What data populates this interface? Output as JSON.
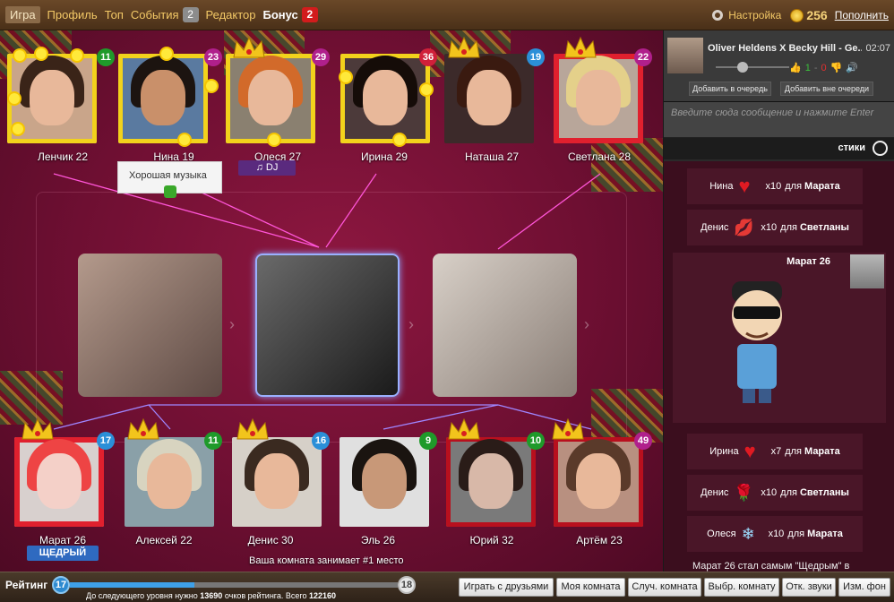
{
  "nav": {
    "items": [
      {
        "label": "Игра"
      },
      {
        "label": "Профиль"
      },
      {
        "label": "Топ"
      },
      {
        "label": "События",
        "badge": "2"
      },
      {
        "label": "Редактор"
      },
      {
        "label": "Бонус",
        "badge": "2"
      }
    ]
  },
  "topright": {
    "settings_label": "Настройка",
    "coins": "256",
    "topup_label": "Пополнить"
  },
  "players_top": [
    {
      "name": "Ленчик 22",
      "level": "11"
    },
    {
      "name": "Нина 19",
      "level": "23"
    },
    {
      "name": "Олеся 27",
      "level": "29",
      "tag": "♫ DJ"
    },
    {
      "name": "Ирина 29",
      "level": "36"
    },
    {
      "name": "Наташа 27",
      "level": "19"
    },
    {
      "name": "Светлана 28",
      "level": "22"
    }
  ],
  "players_bottom": [
    {
      "name": "Марат 26",
      "level": "17",
      "tag": "ЩЕДРЫЙ"
    },
    {
      "name": "Алексей 22",
      "level": "11"
    },
    {
      "name": "Денис 30",
      "level": "16"
    },
    {
      "name": "Эль 26",
      "level": "9"
    },
    {
      "name": "Юрий 32",
      "level": "10"
    },
    {
      "name": "Артём 23",
      "level": "49"
    }
  ],
  "tooltip": {
    "text": "Хорошая музыка"
  },
  "room_rank": "Ваша комната занимает #1 место",
  "player": {
    "track": "Oliver Heldens X Becky Hill - Ge...",
    "time": "02:07",
    "likes": "1",
    "dislikes": "0",
    "queue_label": "Добавить в очередь",
    "queue_out_label": "Добавить вне очереди"
  },
  "chat": {
    "placeholder": "Введите сюда сообщение и нажмите Enter",
    "stickers_label": "стики"
  },
  "feed": {
    "gifts_top": [
      {
        "from": "Нина",
        "count": "x10",
        "for_word": "для",
        "to": "Марата",
        "icon": "heart-icon"
      },
      {
        "from": "Денис",
        "count": "x10",
        "for_word": "для",
        "to": "Светланы",
        "icon": "kiss-icon"
      }
    ],
    "post": {
      "author": "Марат 26"
    },
    "gifts_bottom": [
      {
        "from": "Ирина",
        "count": "x7",
        "for_word": "для",
        "to": "Марата",
        "icon": "heart-icon"
      },
      {
        "from": "Денис",
        "count": "x10",
        "for_word": "для",
        "to": "Светланы",
        "icon": "rose-icon"
      },
      {
        "from": "Олеся",
        "count": "x10",
        "for_word": "для",
        "to": "Марата",
        "icon": "snowflake-icon"
      }
    ],
    "tail": "Марат 26 стал самым \"Щедрым\" в"
  },
  "rating": {
    "label": "Рейтинг",
    "level_current": "17",
    "level_next": "18",
    "progress": 0.38,
    "note_prefix": "До следующего уровня нужно",
    "points_needed": "13690",
    "note_mid": "очков рейтинга. Всего",
    "total": "122160"
  },
  "bottom_buttons": [
    "Играть с друзьями",
    "Моя комната",
    "Случ. комната",
    "Выбр. комнату",
    "Отк. звуки",
    "Изм. фон"
  ]
}
